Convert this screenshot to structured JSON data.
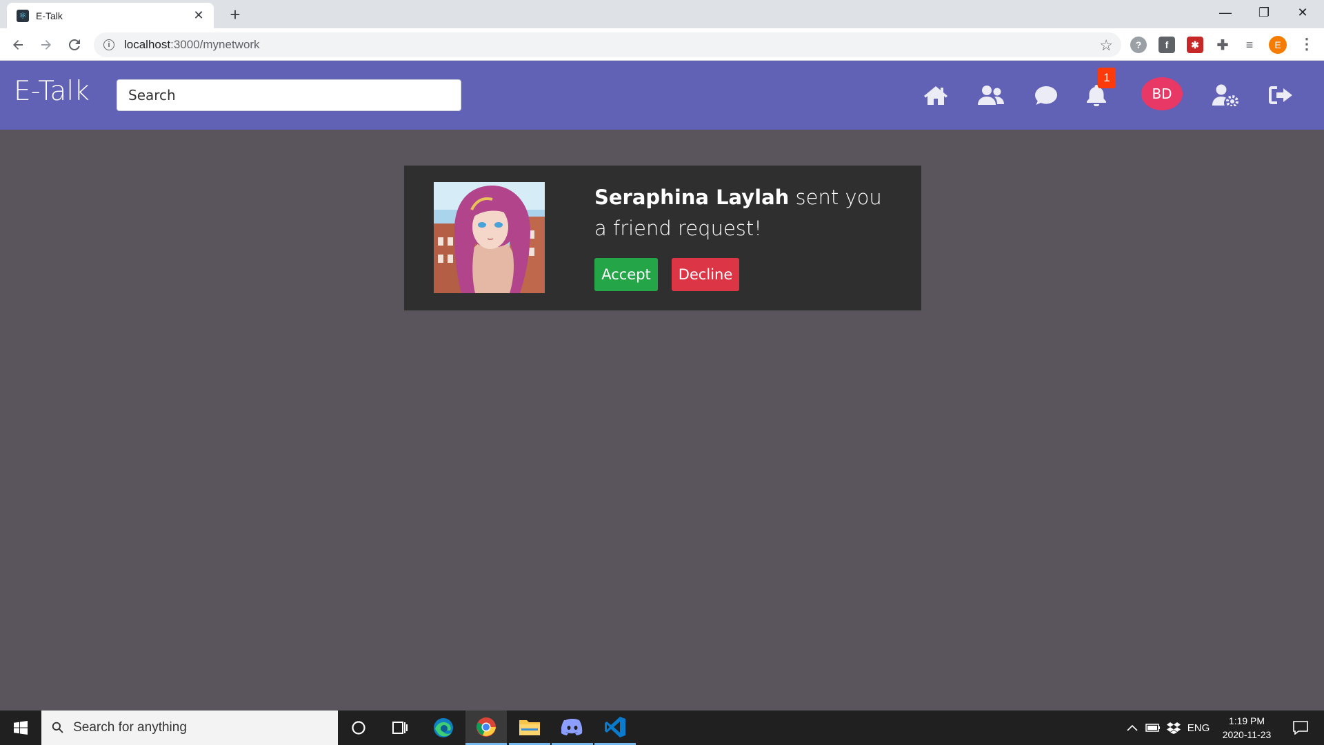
{
  "browser": {
    "tab_title": "E-Talk",
    "url_host": "localhost",
    "url_path": ":3000/mynetwork",
    "profile_initial": "E"
  },
  "app": {
    "brand": "E-Talk",
    "search_placeholder": "Search",
    "nav": [
      {
        "icon": "home-icon"
      },
      {
        "icon": "friends-icon"
      },
      {
        "icon": "chat-icon"
      },
      {
        "icon": "bell-icon"
      },
      {
        "icon": "user-settings-icon"
      },
      {
        "icon": "logout-icon"
      }
    ],
    "notification_count": "1",
    "user_initials": "BD",
    "accent_color": "#6161b5",
    "avatar_color": "#e83866"
  },
  "friend_request": {
    "sender_name": "Seraphina Laylah",
    "message": " sent you a friend request!",
    "accept_label": "Accept",
    "decline_label": "Decline",
    "accept_color": "#24a547",
    "decline_color": "#dc3545"
  },
  "taskbar": {
    "search_placeholder": "Search for anything",
    "language": "ENG",
    "time": "1:19 PM",
    "date": "2020-11-23"
  }
}
